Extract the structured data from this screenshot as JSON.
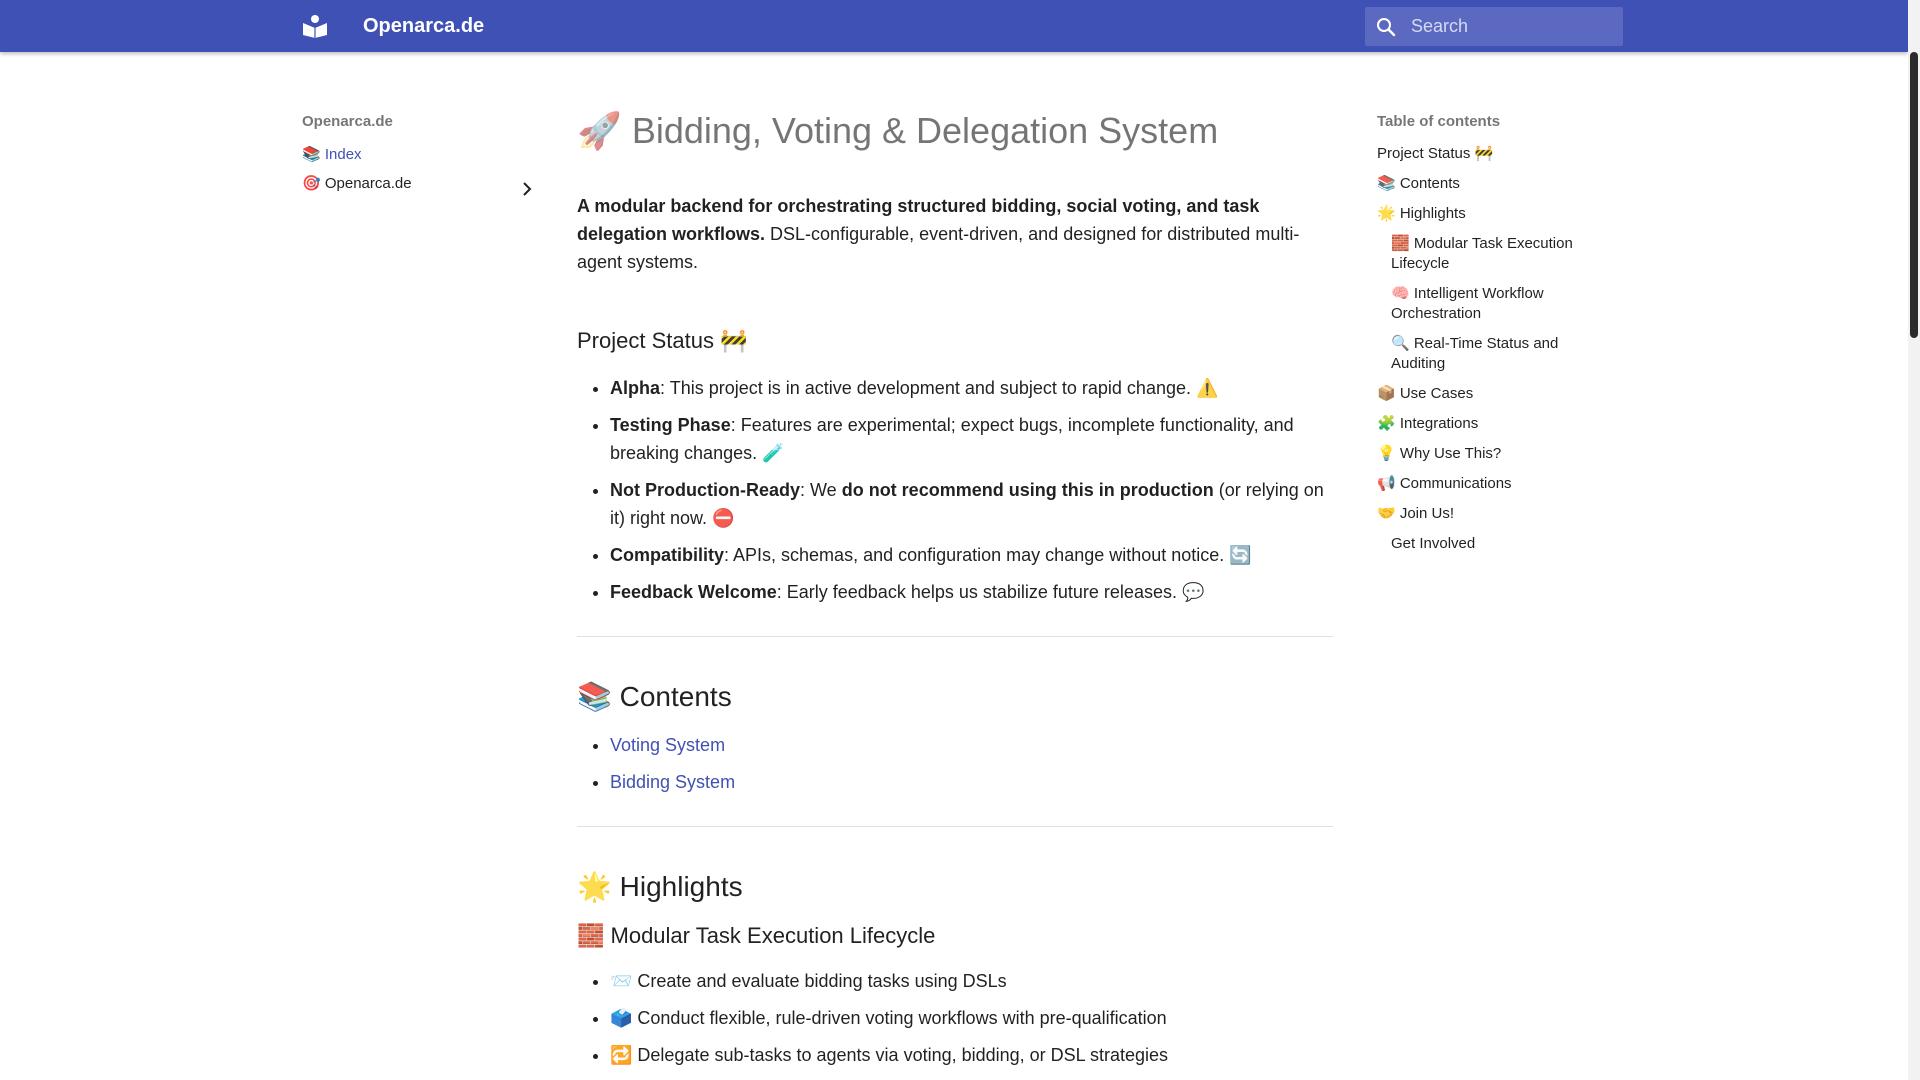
{
  "header": {
    "site_title": "Openarca.de",
    "search_placeholder": "Search",
    "color": "#3f51b5"
  },
  "left_nav": {
    "title": "Openarca.de",
    "items": [
      {
        "label": "📚 Index",
        "active": true
      },
      {
        "label": "🎯 Openarca.de",
        "active": false,
        "has_children": true
      }
    ]
  },
  "main": {
    "title": "🚀 Bidding, Voting & Delegation System",
    "lead_bold": "A modular backend for orchestrating structured bidding, social voting, and task delegation workflows.",
    "lead_rest": " DSL-configurable, event-driven, and designed for distributed multi-agent systems.",
    "project_status": {
      "heading": "Project Status 🚧",
      "items": [
        {
          "term": "Alpha",
          "text": ": This project is in active development and subject to rapid change. ⚠️"
        },
        {
          "term": "Testing Phase",
          "text": ": Features are experimental; expect bugs, incomplete functionality, and breaking changes. 🧪"
        },
        {
          "term": "Not Production-Ready",
          "mid": ": We ",
          "mid_bold": "do not recommend using this in production",
          "text": " (or relying on it) right now. ⛔"
        },
        {
          "term": "Compatibility",
          "text": ": APIs, schemas, and configuration may change without notice. 🔄"
        },
        {
          "term": "Feedback Welcome",
          "text": ": Early feedback helps us stabilize future releases. 💬"
        }
      ]
    },
    "contents": {
      "heading": "📚 Contents",
      "links": [
        "Voting System",
        "Bidding System"
      ]
    },
    "highlights": {
      "heading": "🌟 Highlights",
      "subheading": "🧱 Modular Task Execution Lifecycle",
      "items": [
        "📨 Create and evaluate bidding tasks using DSLs",
        "🗳️ Conduct flexible, rule-driven voting workflows with pre-qualification",
        "🔁 Delegate sub-tasks to agents via voting, bidding, or DSL strategies"
      ]
    }
  },
  "toc": {
    "title": "Table of contents",
    "items": [
      {
        "label": "Project Status 🚧",
        "level": 1
      },
      {
        "label": "📚 Contents",
        "level": 1
      },
      {
        "label": "🌟 Highlights",
        "level": 1
      },
      {
        "label": "🧱 Modular Task Execution Lifecycle",
        "level": 2
      },
      {
        "label": "🧠 Intelligent Workflow Orchestration",
        "level": 2
      },
      {
        "label": "🔍 Real-Time Status and Auditing",
        "level": 2
      },
      {
        "label": "📦 Use Cases",
        "level": 1
      },
      {
        "label": "🧩 Integrations",
        "level": 1
      },
      {
        "label": "💡 Why Use This?",
        "level": 1
      },
      {
        "label": "📢 Communications",
        "level": 1
      },
      {
        "label": "🤝 Join Us!",
        "level": 1
      },
      {
        "label": "Get Involved",
        "level": 2
      }
    ]
  }
}
